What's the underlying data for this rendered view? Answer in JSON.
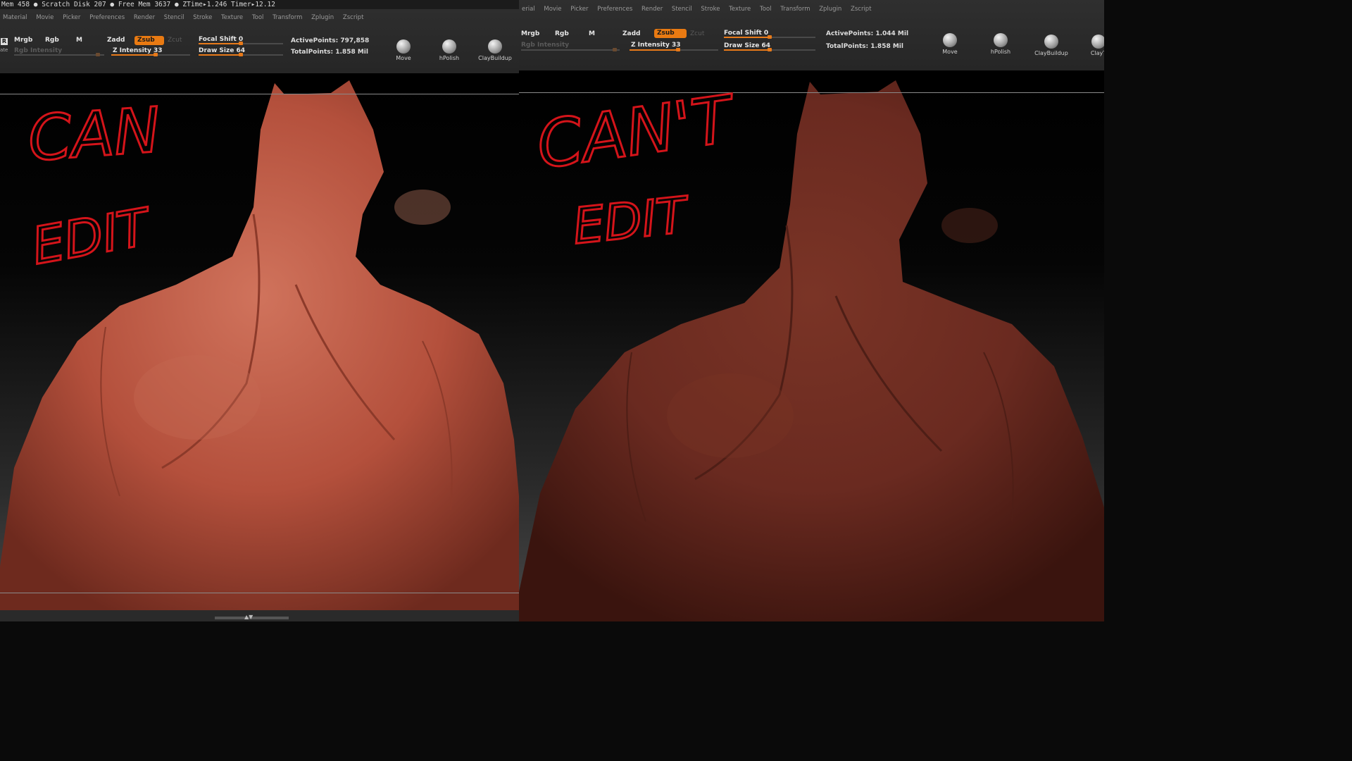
{
  "left": {
    "status": "Mem 458 ● Scratch Disk 207 ● Free Mem 3637 ● ZTime▸1.246 Timer▸12.12",
    "menus": [
      "Material",
      "Movie",
      "Picker",
      "Preferences",
      "Render",
      "Stencil",
      "Stroke",
      "Texture",
      "Tool",
      "Transform",
      "Zplugin",
      "Zscript"
    ],
    "side_fragment": "ate",
    "r_button": "R",
    "mrgb": "Mrgb",
    "rgb": "Rgb",
    "m": "M",
    "zadd": "Zadd",
    "zsub": "Zsub",
    "zcut": "Zcut",
    "rgb_intensity": "Rgb Intensity",
    "z_intensity": "Z Intensity 33",
    "focal_shift": "Focal Shift 0",
    "draw_size": "Draw Size 64",
    "active_points": "ActivePoints: 797,858",
    "total_points": "TotalPoints: 1.858 Mil",
    "brushes": [
      "Move",
      "hPolish",
      "ClayBuildup"
    ],
    "annotation_line1": "CAN",
    "annotation_line2": "EDIT"
  },
  "right": {
    "menus": [
      "erial",
      "Movie",
      "Picker",
      "Preferences",
      "Render",
      "Stencil",
      "Stroke",
      "Texture",
      "Tool",
      "Transform",
      "Zplugin",
      "Zscript"
    ],
    "mrgb": "Mrgb",
    "rgb": "Rgb",
    "m": "M",
    "zadd": "Zadd",
    "zsub": "Zsub",
    "zcut": "Zcut",
    "rgb_intensity": "Rgb Intensity",
    "z_intensity": "Z Intensity 33",
    "focal_shift": "Focal Shift 0",
    "draw_size": "Draw Size 64",
    "active_points": "ActivePoints: 1.044 Mil",
    "total_points": "TotalPoints: 1.858 Mil",
    "brushes": [
      "Move",
      "hPolish",
      "ClayBuildup",
      "ClayT"
    ],
    "annotation_line1": "CAN'T",
    "annotation_line2": "EDIT"
  },
  "colors": {
    "accent_orange": "#e97a12",
    "annotation_red": "#d4141a",
    "model_left": "#b4503c",
    "model_right": "#6a2a20"
  }
}
